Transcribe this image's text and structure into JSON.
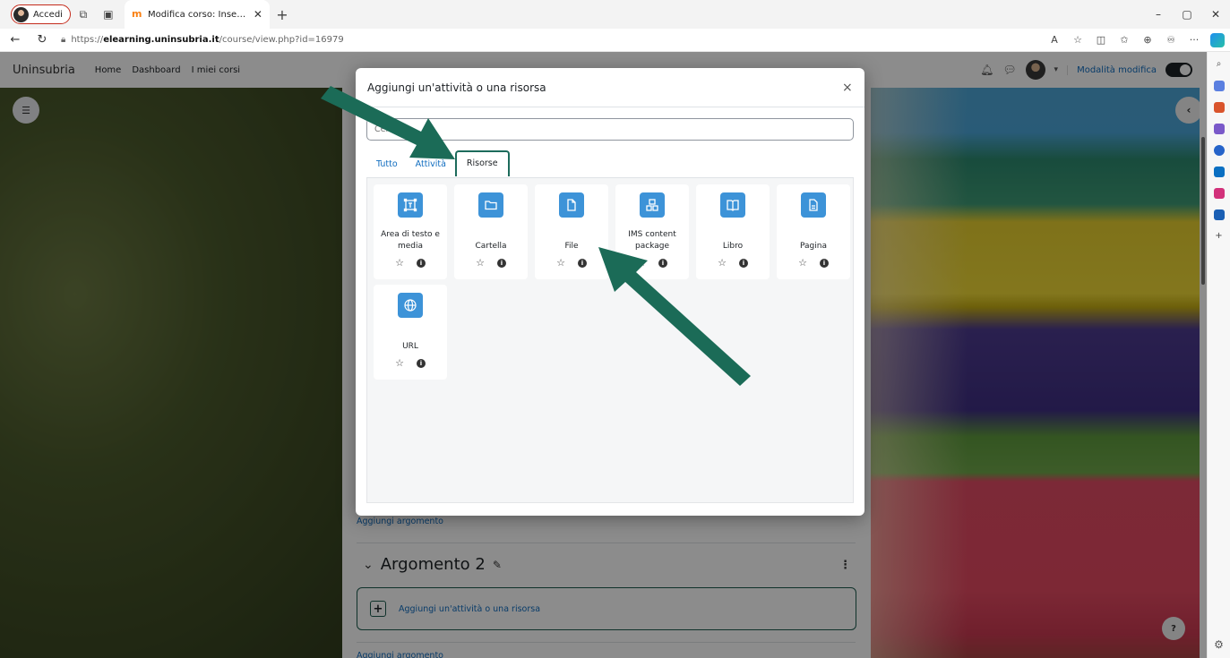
{
  "browser": {
    "profile_label": "Accedi",
    "tab_title": "Modifica corso: Insegnamento di",
    "url_prefix": "https://",
    "url_host": "elearning.uninsubria.it",
    "url_path": "/course/view.php?id=16979"
  },
  "moodle_nav": {
    "brand": "Uninsubria",
    "links": [
      "Home",
      "Dashboard",
      "I miei corsi"
    ],
    "edit_mode_label": "Modalità modifica",
    "edit_mode_on": true
  },
  "course": {
    "add_topic_1": "Aggiungi argomento",
    "section_title": "Argomento 2",
    "add_activity": "Aggiungi un'attività o una risorsa",
    "add_topic_2": "Aggiungi argomento",
    "help": "?"
  },
  "modal": {
    "title": "Aggiungi un'attività o una risorsa",
    "search_placeholder": "Cerca",
    "tabs": [
      {
        "label": "Tutto",
        "active": false
      },
      {
        "label": "Attività",
        "active": false
      },
      {
        "label": "Risorse",
        "active": true
      }
    ],
    "items": [
      {
        "label": "Area di testo e media",
        "icon": "text-media-icon"
      },
      {
        "label": "Cartella",
        "icon": "folder-icon"
      },
      {
        "label": "File",
        "icon": "file-icon"
      },
      {
        "label": "IMS content package",
        "icon": "package-icon"
      },
      {
        "label": "Libro",
        "icon": "book-icon"
      },
      {
        "label": "Pagina",
        "icon": "page-icon"
      },
      {
        "label": "URL",
        "icon": "globe-icon"
      }
    ]
  },
  "colors": {
    "icon_bg": "#3d93d8",
    "link": "#0f6cbf",
    "arrow": "#1b6b57",
    "active_tab_border": "#1d6b5c"
  }
}
